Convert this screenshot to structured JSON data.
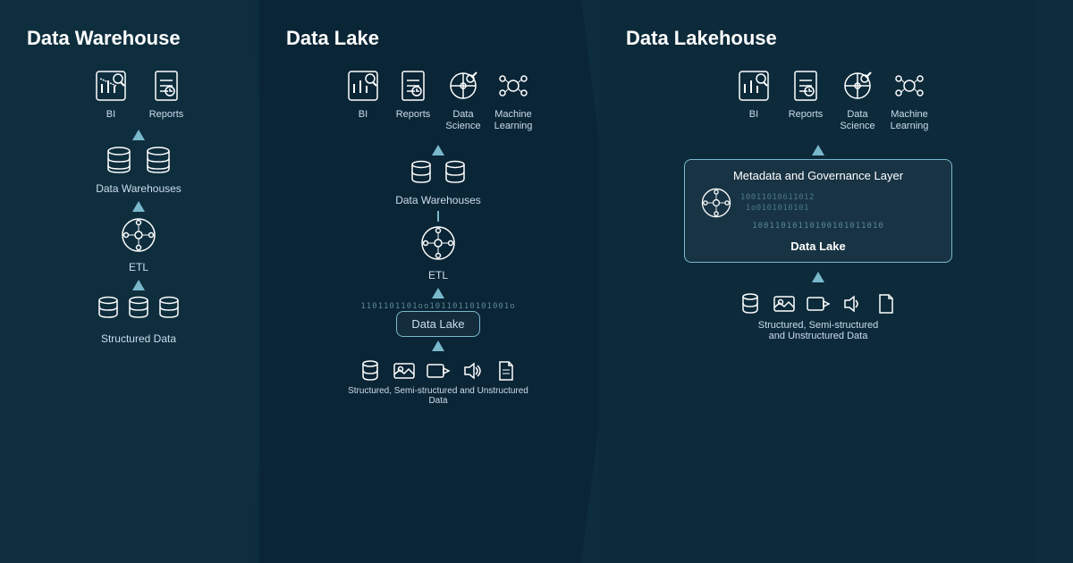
{
  "sections": {
    "dw": {
      "title": "Data Warehouse",
      "icons_top": [
        {
          "label": "BI",
          "icon": "bi"
        },
        {
          "label": "Reports",
          "icon": "reports"
        }
      ],
      "node1": {
        "label": "Data Warehouses",
        "icon": "warehouse"
      },
      "node2": {
        "label": "ETL",
        "icon": "etl"
      },
      "node3": {
        "label": "Structured Data",
        "icon": "structured"
      }
    },
    "dl": {
      "title": "Data Lake",
      "icons_top": [
        {
          "label": "BI",
          "icon": "bi"
        },
        {
          "label": "Reports",
          "icon": "reports"
        },
        {
          "label": "Data Science",
          "icon": "datascience"
        },
        {
          "label": "Machine Learning",
          "icon": "ml"
        }
      ],
      "node1": {
        "label": "Data Warehouses",
        "icon": "warehouse"
      },
      "node2": {
        "label": "ETL",
        "icon": "etl"
      },
      "node3": {
        "label": "Data Lake",
        "icon": "lake"
      },
      "node4": {
        "label": "Structured, Semi-structured and Unstructured Data",
        "icon": "mixed"
      }
    },
    "dlh": {
      "title": "Data Lakehouse",
      "icons_top": [
        {
          "label": "BI",
          "icon": "bi"
        },
        {
          "label": "Reports",
          "icon": "reports"
        },
        {
          "label": "Data Science",
          "icon": "datascience"
        },
        {
          "label": "Machine Learning",
          "icon": "ml"
        }
      ],
      "metadata_box": {
        "title": "Metadata and Governance Layer",
        "binary": "10011010611012",
        "sublabel": "Data Lake"
      },
      "node1": {
        "label": "Structured, Semi-structured\nand Unstructured Data",
        "icon": "mixed"
      }
    }
  },
  "wave": "1101101101oo10110110101001o",
  "binary_display": "100110101101 0101010"
}
